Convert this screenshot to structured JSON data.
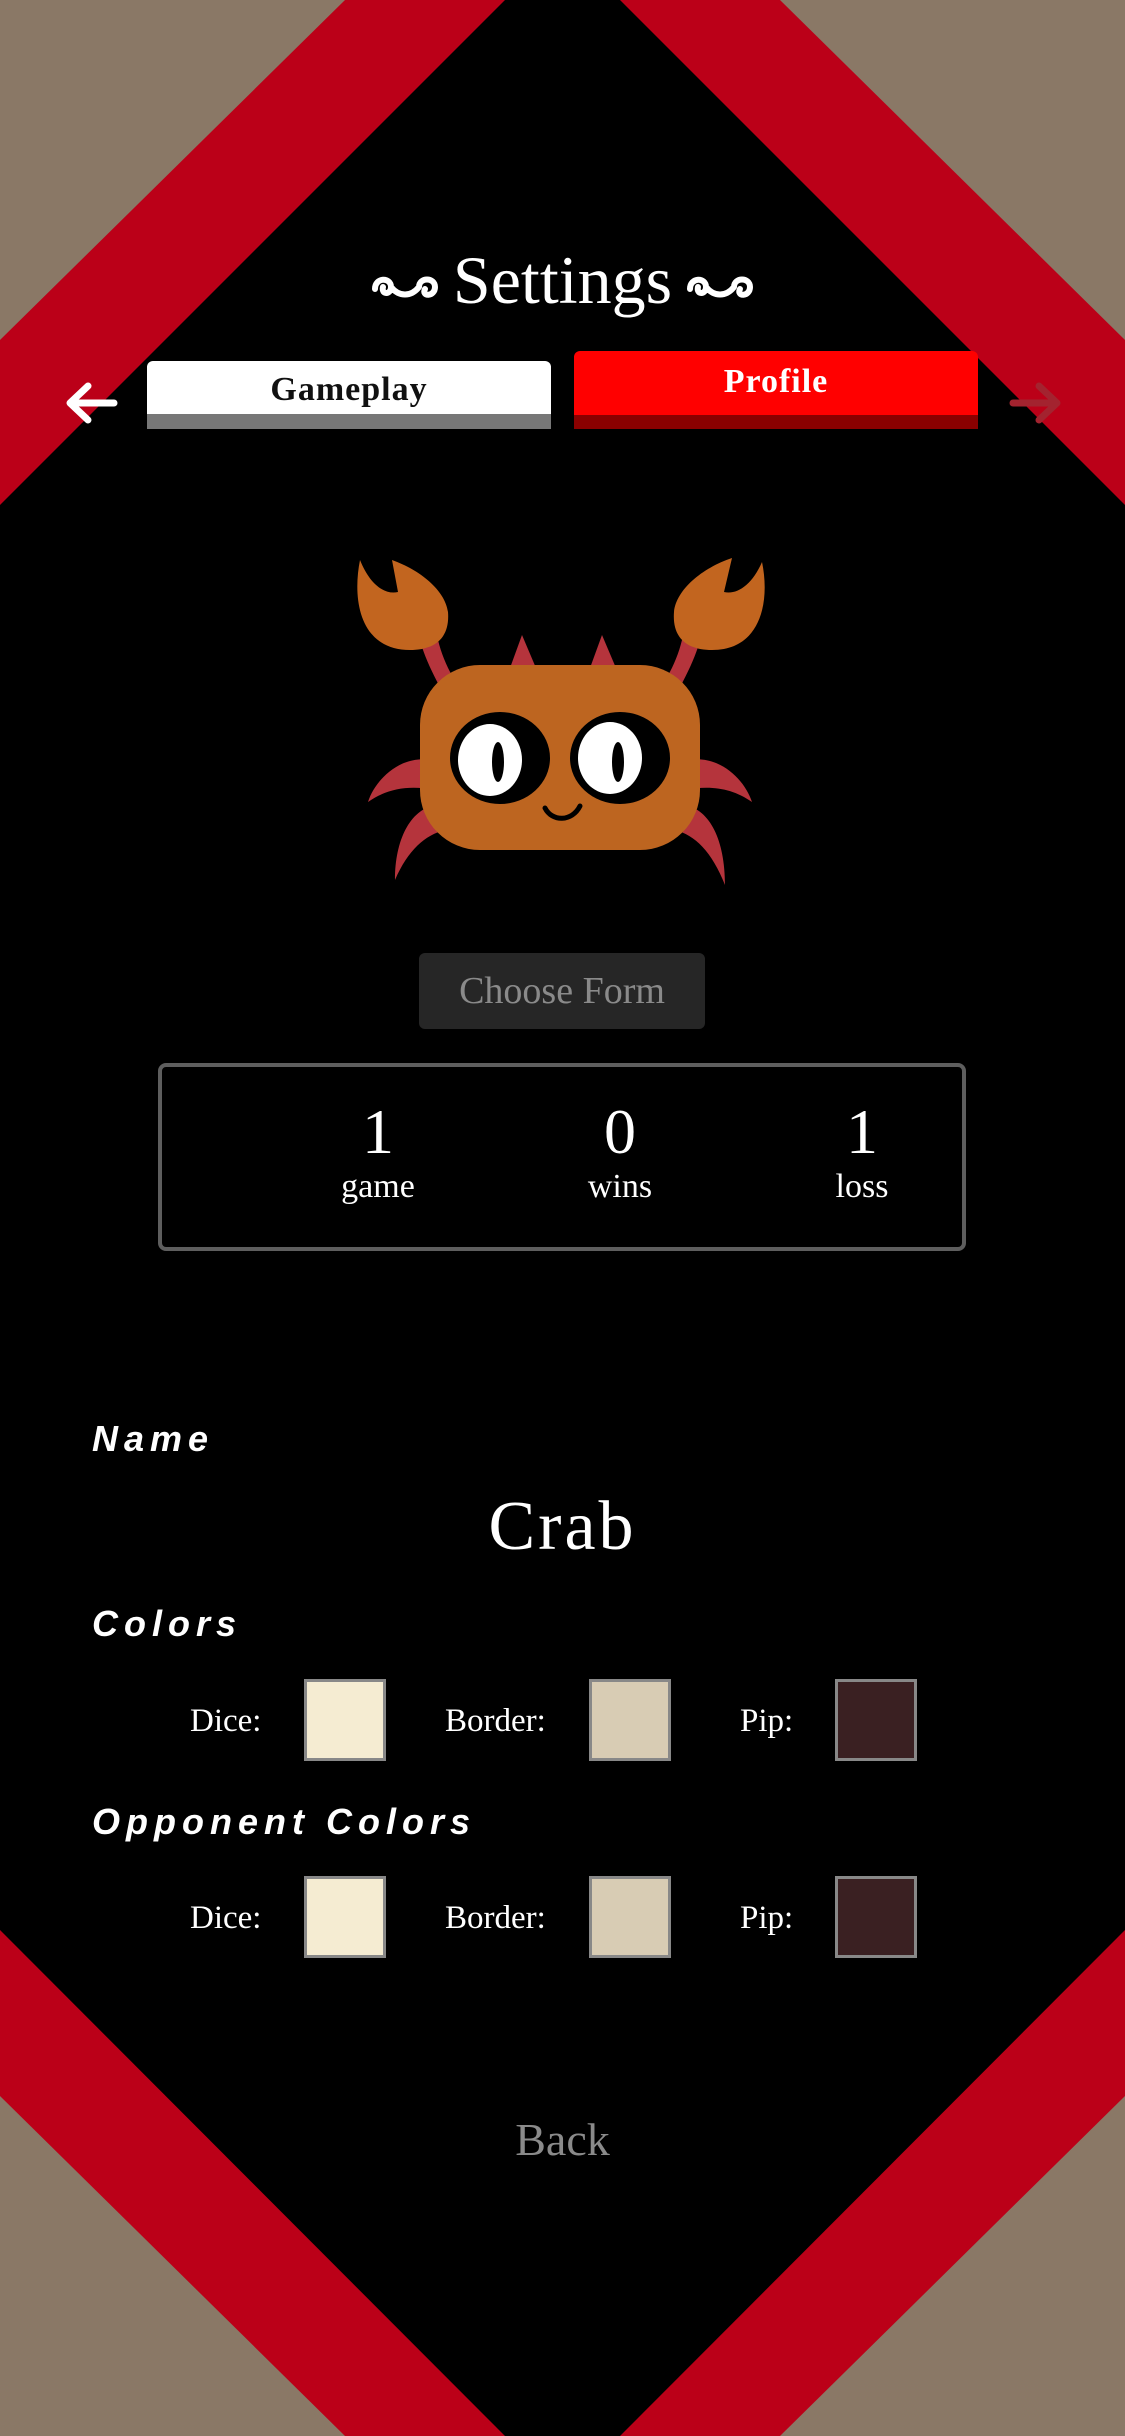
{
  "title": "Settings",
  "tabs": {
    "gameplay": "Gameplay",
    "profile": "Profile"
  },
  "avatar": {
    "name": "crab-icon"
  },
  "choose_form": "Choose Form",
  "stats": [
    {
      "value": "1",
      "label": "game"
    },
    {
      "value": "0",
      "label": "wins"
    },
    {
      "value": "1",
      "label": "loss"
    }
  ],
  "name_section": {
    "label": "Name",
    "value": "Crab"
  },
  "colors": {
    "label": "Colors",
    "dice_label": "Dice:",
    "dice": "#f5ecd2",
    "border_label": "Border:",
    "border": "#d8ccb4",
    "pip_label": "Pip:",
    "pip": "#3a2022"
  },
  "opponent_colors": {
    "label": "Opponent Colors",
    "dice_label": "Dice:",
    "dice": "#f5ecd2",
    "border_label": "Border:",
    "border": "#d8ccb4",
    "pip_label": "Pip:",
    "pip": "#3a2022"
  },
  "back": "Back",
  "theme": {
    "accent": "#ff0000",
    "band": "#bb0018",
    "bg": "#8a7866"
  }
}
